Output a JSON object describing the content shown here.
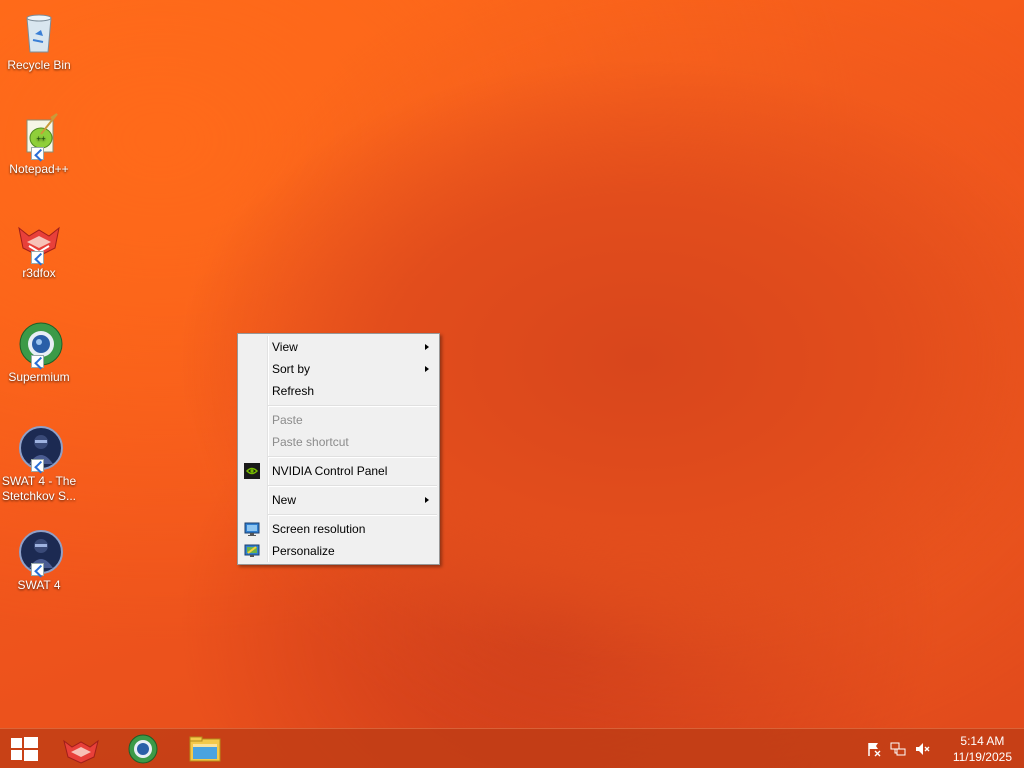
{
  "desktop_icons": [
    {
      "label": "Recycle Bin",
      "icon": "recycle-bin-icon"
    },
    {
      "label": "Notepad++",
      "icon": "notepad-plus-plus-icon"
    },
    {
      "label": "r3dfox",
      "icon": "r3dfox-icon"
    },
    {
      "label": "Supermium",
      "icon": "supermium-icon"
    },
    {
      "label": "SWAT 4 - The Stetchkov S...",
      "icon": "swat4-tss-icon"
    },
    {
      "label": "SWAT 4",
      "icon": "swat4-icon"
    }
  ],
  "context_menu": {
    "view": "View",
    "sort_by": "Sort by",
    "refresh": "Refresh",
    "paste": "Paste",
    "paste_shortcut": "Paste shortcut",
    "nvidia": "NVIDIA Control Panel",
    "new": "New",
    "screen_resolution": "Screen resolution",
    "personalize": "Personalize"
  },
  "taskbar": {
    "apps": [
      "r3dfox",
      "Supermium",
      "File Explorer"
    ],
    "tray_icons": [
      "action-center-flag-icon",
      "network-icon",
      "volume-muted-icon"
    ],
    "time": "5:14 AM",
    "date": "11/19/2025"
  },
  "colors": {
    "wallpaper": "#f2561c",
    "menu_bg": "#f0f0f0",
    "taskbar": "#be3c14"
  }
}
